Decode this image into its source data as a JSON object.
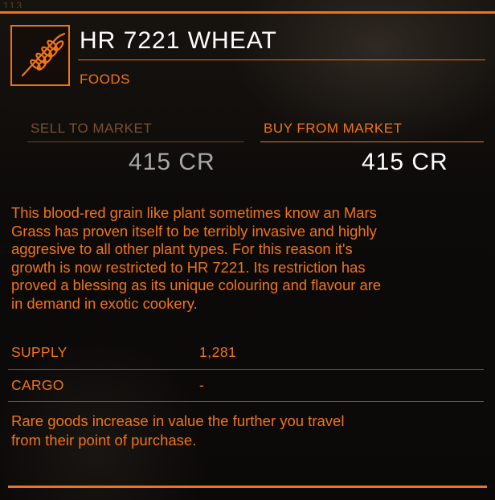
{
  "header": {
    "top_ghost_text": "113",
    "title": "HR 7221 WHEAT",
    "category": "FOODS",
    "icon": "wheat-icon"
  },
  "market": {
    "sell_label": "SELL TO MARKET",
    "sell_value": "415 CR",
    "buy_label": "BUY FROM MARKET",
    "buy_value": "415 CR"
  },
  "description": "This blood-red grain like plant sometimes know an Mars\nGrass has proven itself to be terribly invasive and highly\naggresive to all other plant types.  For this reason it's\ngrowth is now restricted to  HR 7221. Its restriction has\nproved a blessing as its unique colouring and flavour are\nin demand in exotic cookery.",
  "stats": {
    "supply_label": "SUPPLY",
    "supply_value": "1,281",
    "cargo_label": "CARGO",
    "cargo_value": "-"
  },
  "footer_note": "Rare goods increase in value the further you travel\nfrom their point of purchase.",
  "colors": {
    "accent": "#f07414",
    "title": "#ffffff",
    "muted": "#7a5030",
    "sell_value": "#a8a8a8",
    "background": "#0d0b09"
  }
}
